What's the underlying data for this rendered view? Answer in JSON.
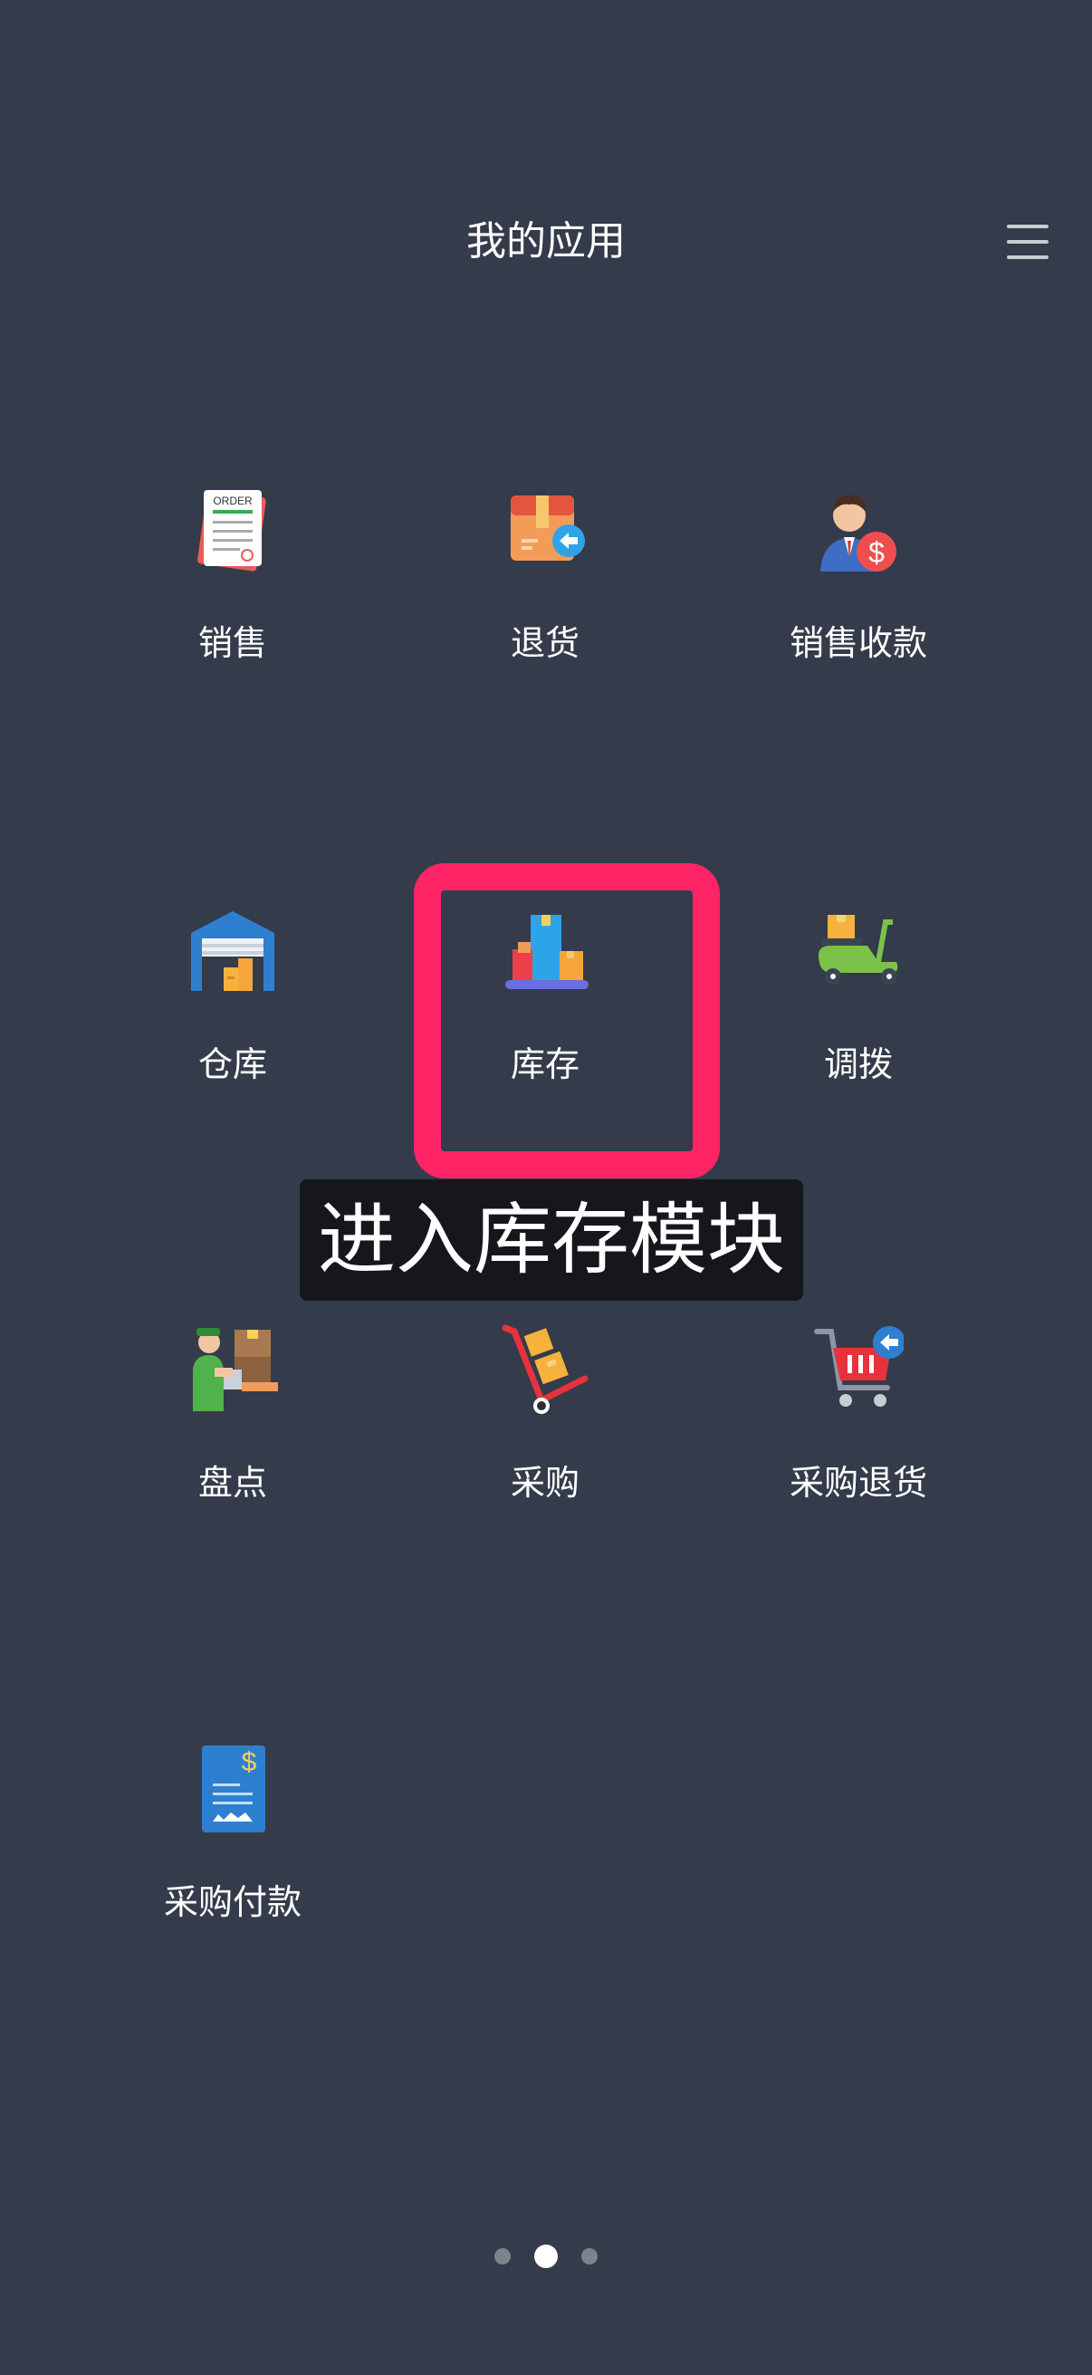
{
  "header": {
    "title": "我的应用"
  },
  "apps": [
    {
      "label": "销售",
      "icon": "order-document-icon"
    },
    {
      "label": "退货",
      "icon": "return-box-icon"
    },
    {
      "label": "销售收款",
      "icon": "salesman-money-icon"
    },
    {
      "label": "仓库",
      "icon": "warehouse-icon"
    },
    {
      "label": "库存",
      "icon": "inventory-boxes-icon"
    },
    {
      "label": "调拨",
      "icon": "scooter-delivery-icon"
    },
    {
      "label": "盘点",
      "icon": "worker-boxes-icon"
    },
    {
      "label": "采购",
      "icon": "hand-truck-icon"
    },
    {
      "label": "采购退货",
      "icon": "cart-return-icon"
    },
    {
      "label": "采购付款",
      "icon": "invoice-dollar-icon"
    }
  ],
  "icon_text": {
    "order": "ORDER",
    "dollar": "$"
  },
  "overlay": {
    "caption": "进入库存模块",
    "highlight_color": "#ff2466"
  },
  "pager": {
    "pages": 3,
    "active_index": 1
  },
  "colors": {
    "background": "#343b4a"
  }
}
